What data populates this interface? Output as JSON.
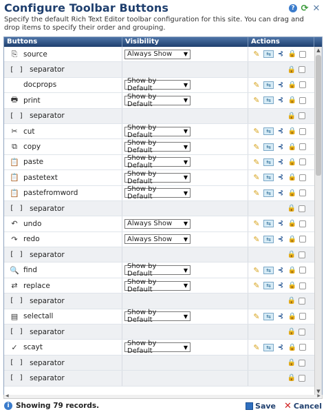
{
  "header": {
    "title": "Configure Toolbar Buttons",
    "description": "Specify the default Rich Text Editor toolbar configuration for this site. You can drag and drop items to specify their order and grouping.",
    "help_icon": "help-icon",
    "refresh_icon": "refresh-icon",
    "close_icon": "close-icon"
  },
  "columns": {
    "buttons": "Buttons",
    "visibility": "Visibility",
    "actions": "Actions"
  },
  "rows": [
    {
      "name": "source",
      "icon": "source-icon",
      "glyph": "⎘",
      "visibility": "Always Show",
      "actions": true
    },
    {
      "name": "separator",
      "icon": "separator-icon",
      "glyph": "[ ]",
      "visibility": "",
      "actions": false
    },
    {
      "name": "docprops",
      "icon": "",
      "glyph": "",
      "visibility": "Show by Default",
      "actions": true
    },
    {
      "name": "print",
      "icon": "print-icon",
      "glyph": "🖶",
      "visibility": "Show by Default",
      "actions": true
    },
    {
      "name": "separator",
      "icon": "separator-icon",
      "glyph": "[ ]",
      "visibility": "",
      "actions": false
    },
    {
      "name": "cut",
      "icon": "cut-icon",
      "glyph": "✂",
      "visibility": "Show by Default",
      "actions": true
    },
    {
      "name": "copy",
      "icon": "copy-icon",
      "glyph": "⧉",
      "visibility": "Show by Default",
      "actions": true
    },
    {
      "name": "paste",
      "icon": "paste-icon",
      "glyph": "📋",
      "visibility": "Show by Default",
      "actions": true
    },
    {
      "name": "pastetext",
      "icon": "pastetext-icon",
      "glyph": "📋",
      "visibility": "Show by Default",
      "actions": true
    },
    {
      "name": "pastefromword",
      "icon": "pastefromword-icon",
      "glyph": "📋",
      "visibility": "Show by Default",
      "actions": true
    },
    {
      "name": "separator",
      "icon": "separator-icon",
      "glyph": "[ ]",
      "visibility": "",
      "actions": false
    },
    {
      "name": "undo",
      "icon": "undo-icon",
      "glyph": "↶",
      "visibility": "Always Show",
      "actions": true
    },
    {
      "name": "redo",
      "icon": "redo-icon",
      "glyph": "↷",
      "visibility": "Always Show",
      "actions": true
    },
    {
      "name": "separator",
      "icon": "separator-icon",
      "glyph": "[ ]",
      "visibility": "",
      "actions": false
    },
    {
      "name": "find",
      "icon": "find-icon",
      "glyph": "🔍",
      "visibility": "Show by Default",
      "actions": true
    },
    {
      "name": "replace",
      "icon": "replace-icon",
      "glyph": "⇄",
      "visibility": "Show by Default",
      "actions": true
    },
    {
      "name": "separator",
      "icon": "separator-icon",
      "glyph": "[ ]",
      "visibility": "",
      "actions": false
    },
    {
      "name": "selectall",
      "icon": "selectall-icon",
      "glyph": "▤",
      "visibility": "Show by Default",
      "actions": true
    },
    {
      "name": "separator",
      "icon": "separator-icon",
      "glyph": "[ ]",
      "visibility": "",
      "actions": false
    },
    {
      "name": "scayt",
      "icon": "scayt-icon",
      "glyph": "✓",
      "visibility": "Show by Default",
      "actions": true
    },
    {
      "name": "separator",
      "icon": "separator-icon",
      "glyph": "[ ]",
      "visibility": "",
      "actions": false
    },
    {
      "name": "separator",
      "icon": "separator-icon",
      "glyph": "[ ]",
      "visibility": "",
      "actions": false
    }
  ],
  "footer": {
    "records": "Showing 79 records.",
    "save_label": "Save",
    "cancel_label": "Cancel"
  },
  "colors": {
    "header_bg": "#1f3f6e",
    "title": "#1f3f6e",
    "alt_row": "#eef0f3"
  }
}
